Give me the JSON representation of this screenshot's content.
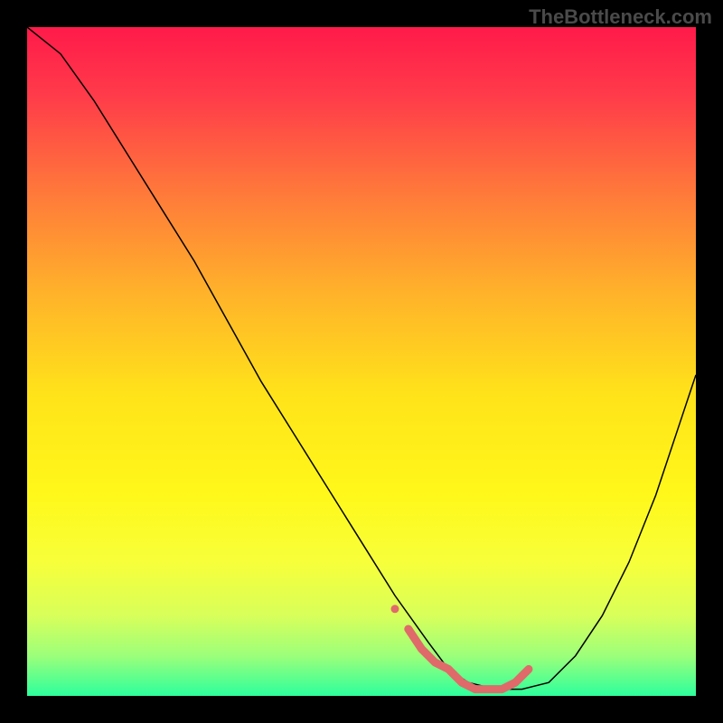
{
  "watermark": "TheBottleneck.com",
  "chart_data": {
    "type": "line",
    "title": "",
    "xlabel": "",
    "ylabel": "",
    "xlim": [
      0,
      100
    ],
    "ylim": [
      0,
      100
    ],
    "grid": false,
    "legend": false,
    "background_gradient": {
      "stops": [
        {
          "offset": 0,
          "color": "#ff1a4a"
        },
        {
          "offset": 0.1,
          "color": "#ff3a4a"
        },
        {
          "offset": 0.25,
          "color": "#ff7a3a"
        },
        {
          "offset": 0.4,
          "color": "#ffb32a"
        },
        {
          "offset": 0.55,
          "color": "#ffe31a"
        },
        {
          "offset": 0.7,
          "color": "#fff81a"
        },
        {
          "offset": 0.8,
          "color": "#f7ff3a"
        },
        {
          "offset": 0.88,
          "color": "#d8ff5a"
        },
        {
          "offset": 0.94,
          "color": "#9cff7a"
        },
        {
          "offset": 1.0,
          "color": "#2dff9c"
        }
      ]
    },
    "series": [
      {
        "name": "curve",
        "color": "#000000",
        "width": 1.5,
        "x": [
          0,
          5,
          10,
          15,
          20,
          25,
          30,
          35,
          40,
          45,
          50,
          55,
          60,
          63,
          66,
          70,
          74,
          78,
          82,
          86,
          90,
          94,
          98,
          100
        ],
        "y": [
          100,
          96,
          89,
          81,
          73,
          65,
          56,
          47,
          39,
          31,
          23,
          15,
          8,
          4,
          2,
          1,
          1,
          2,
          6,
          12,
          20,
          30,
          42,
          48
        ]
      },
      {
        "name": "highlight-segment",
        "color": "#e06a6a",
        "width": 9,
        "rounded": true,
        "x": [
          57,
          59,
          61,
          63,
          65,
          67,
          69,
          71,
          73,
          75
        ],
        "y": [
          10,
          7,
          5,
          4,
          2,
          1,
          1,
          1,
          2,
          4
        ]
      },
      {
        "name": "highlight-dot",
        "color": "#e06a6a",
        "marker": "circle",
        "marker_size": 9,
        "x": [
          55
        ],
        "y": [
          13
        ]
      }
    ]
  }
}
